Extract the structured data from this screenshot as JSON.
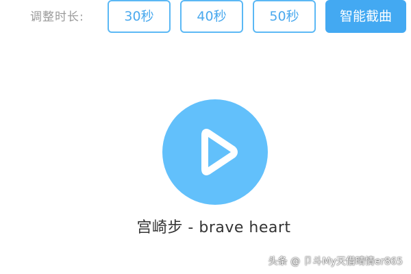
{
  "duration": {
    "label": "调整时长:",
    "options": [
      "30秒",
      "40秒",
      "50秒"
    ],
    "smart_cut_label": "智能截曲"
  },
  "player": {
    "play_icon": "play-icon",
    "song_title": "宫崎步 - brave heart"
  },
  "watermark": "头条 @ 卩斗My天借晴情er865",
  "colors": {
    "accent": "#43a9f2",
    "play_circle": "#62c0fb",
    "button_border": "#5bb8f5",
    "label_gray": "#9a9a9a"
  }
}
